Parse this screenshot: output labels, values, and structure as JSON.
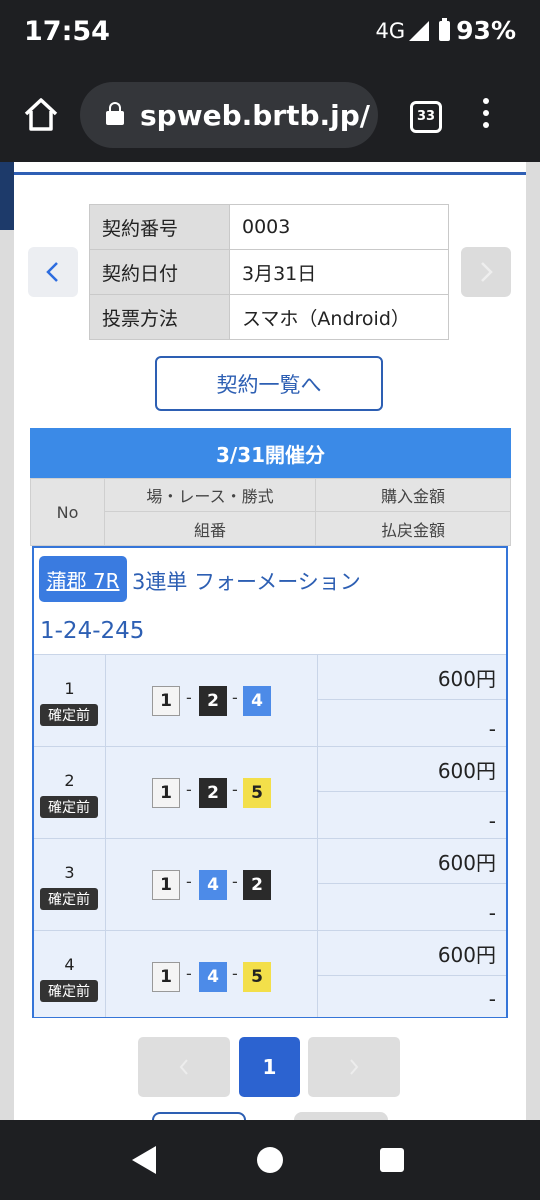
{
  "status_bar": {
    "time": "17:54",
    "network": "4G",
    "battery": "93%"
  },
  "browser": {
    "url": "spweb.brtb.jp/",
    "tab_count": "33"
  },
  "contract": {
    "rows": [
      {
        "key": "契約番号",
        "value": "0003"
      },
      {
        "key": "契約日付",
        "value": "3月31日"
      },
      {
        "key": "投票方法",
        "value": "スマホ（Android）"
      }
    ],
    "list_button": "契約一覧へ"
  },
  "session": {
    "date_label": "3/31開催分",
    "headers": {
      "no": "No",
      "venue_race_bet": "場・レース・勝式",
      "combination": "組番",
      "purchase_amount": "購入金額",
      "payout_amount": "払戻金額"
    },
    "race": {
      "venue_race": "蒲郡 7R",
      "bet_type": "3連単 フォーメーション",
      "combo_summary": "1-24-245"
    },
    "tickets": [
      {
        "no": "1",
        "status": "確定前",
        "boats": [
          "1",
          "2",
          "4"
        ],
        "amount": "600円",
        "payout": "-"
      },
      {
        "no": "2",
        "status": "確定前",
        "boats": [
          "1",
          "2",
          "5"
        ],
        "amount": "600円",
        "payout": "-"
      },
      {
        "no": "3",
        "status": "確定前",
        "boats": [
          "1",
          "4",
          "2"
        ],
        "amount": "600円",
        "payout": "-"
      },
      {
        "no": "4",
        "status": "確定前",
        "boats": [
          "1",
          "4",
          "5"
        ],
        "amount": "600円",
        "payout": "-"
      }
    ]
  },
  "pagination": {
    "current": "1"
  },
  "colors": {
    "accent_blue": "#3b8ae7",
    "boat_1": "#f4f4f4",
    "boat_2": "#2a2a2a",
    "boat_4": "#4d8be8",
    "boat_5": "#f3df4a"
  }
}
